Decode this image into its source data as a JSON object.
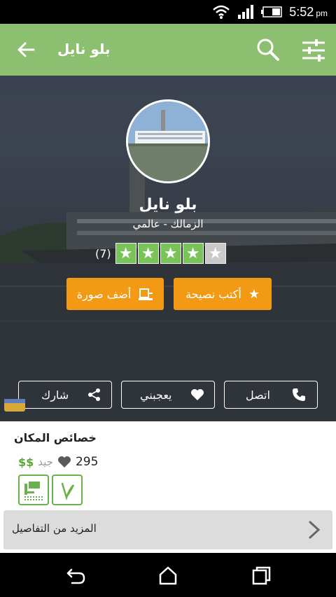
{
  "status_bar": {
    "time": "5:52",
    "ampm": "pm"
  },
  "app_bar": {
    "title": "بلو نايل"
  },
  "hero": {
    "name": "بلو نايل",
    "subtitle": "الزمالك - عالمي",
    "rating": {
      "count_label": "(7)",
      "stars": 4,
      "max": 5
    },
    "add_photo_label": "أضف صورة",
    "write_tip_label": "أكتب نصيحة",
    "share_label": "شارك",
    "like_label": "يعجبني",
    "call_label": "اتصل"
  },
  "details": {
    "section_title": "خصائص المكان",
    "likes_count": "295",
    "quality": "جيد",
    "price": "$$",
    "more_details_label": "المزيد من التفاصيل"
  },
  "colors": {
    "app_bar": "#8cbf6f",
    "accent_orange": "#f29a13",
    "star_green": "#7ac35a",
    "price_green": "#5aa83a"
  },
  "icons": [
    "back-arrow-icon",
    "search-icon",
    "filter-sliders-icon",
    "star-icon",
    "add-photo-icon",
    "share-icon",
    "heart-icon",
    "phone-icon",
    "chevron-right-icon",
    "seating-icon",
    "vegetarian-icon"
  ]
}
